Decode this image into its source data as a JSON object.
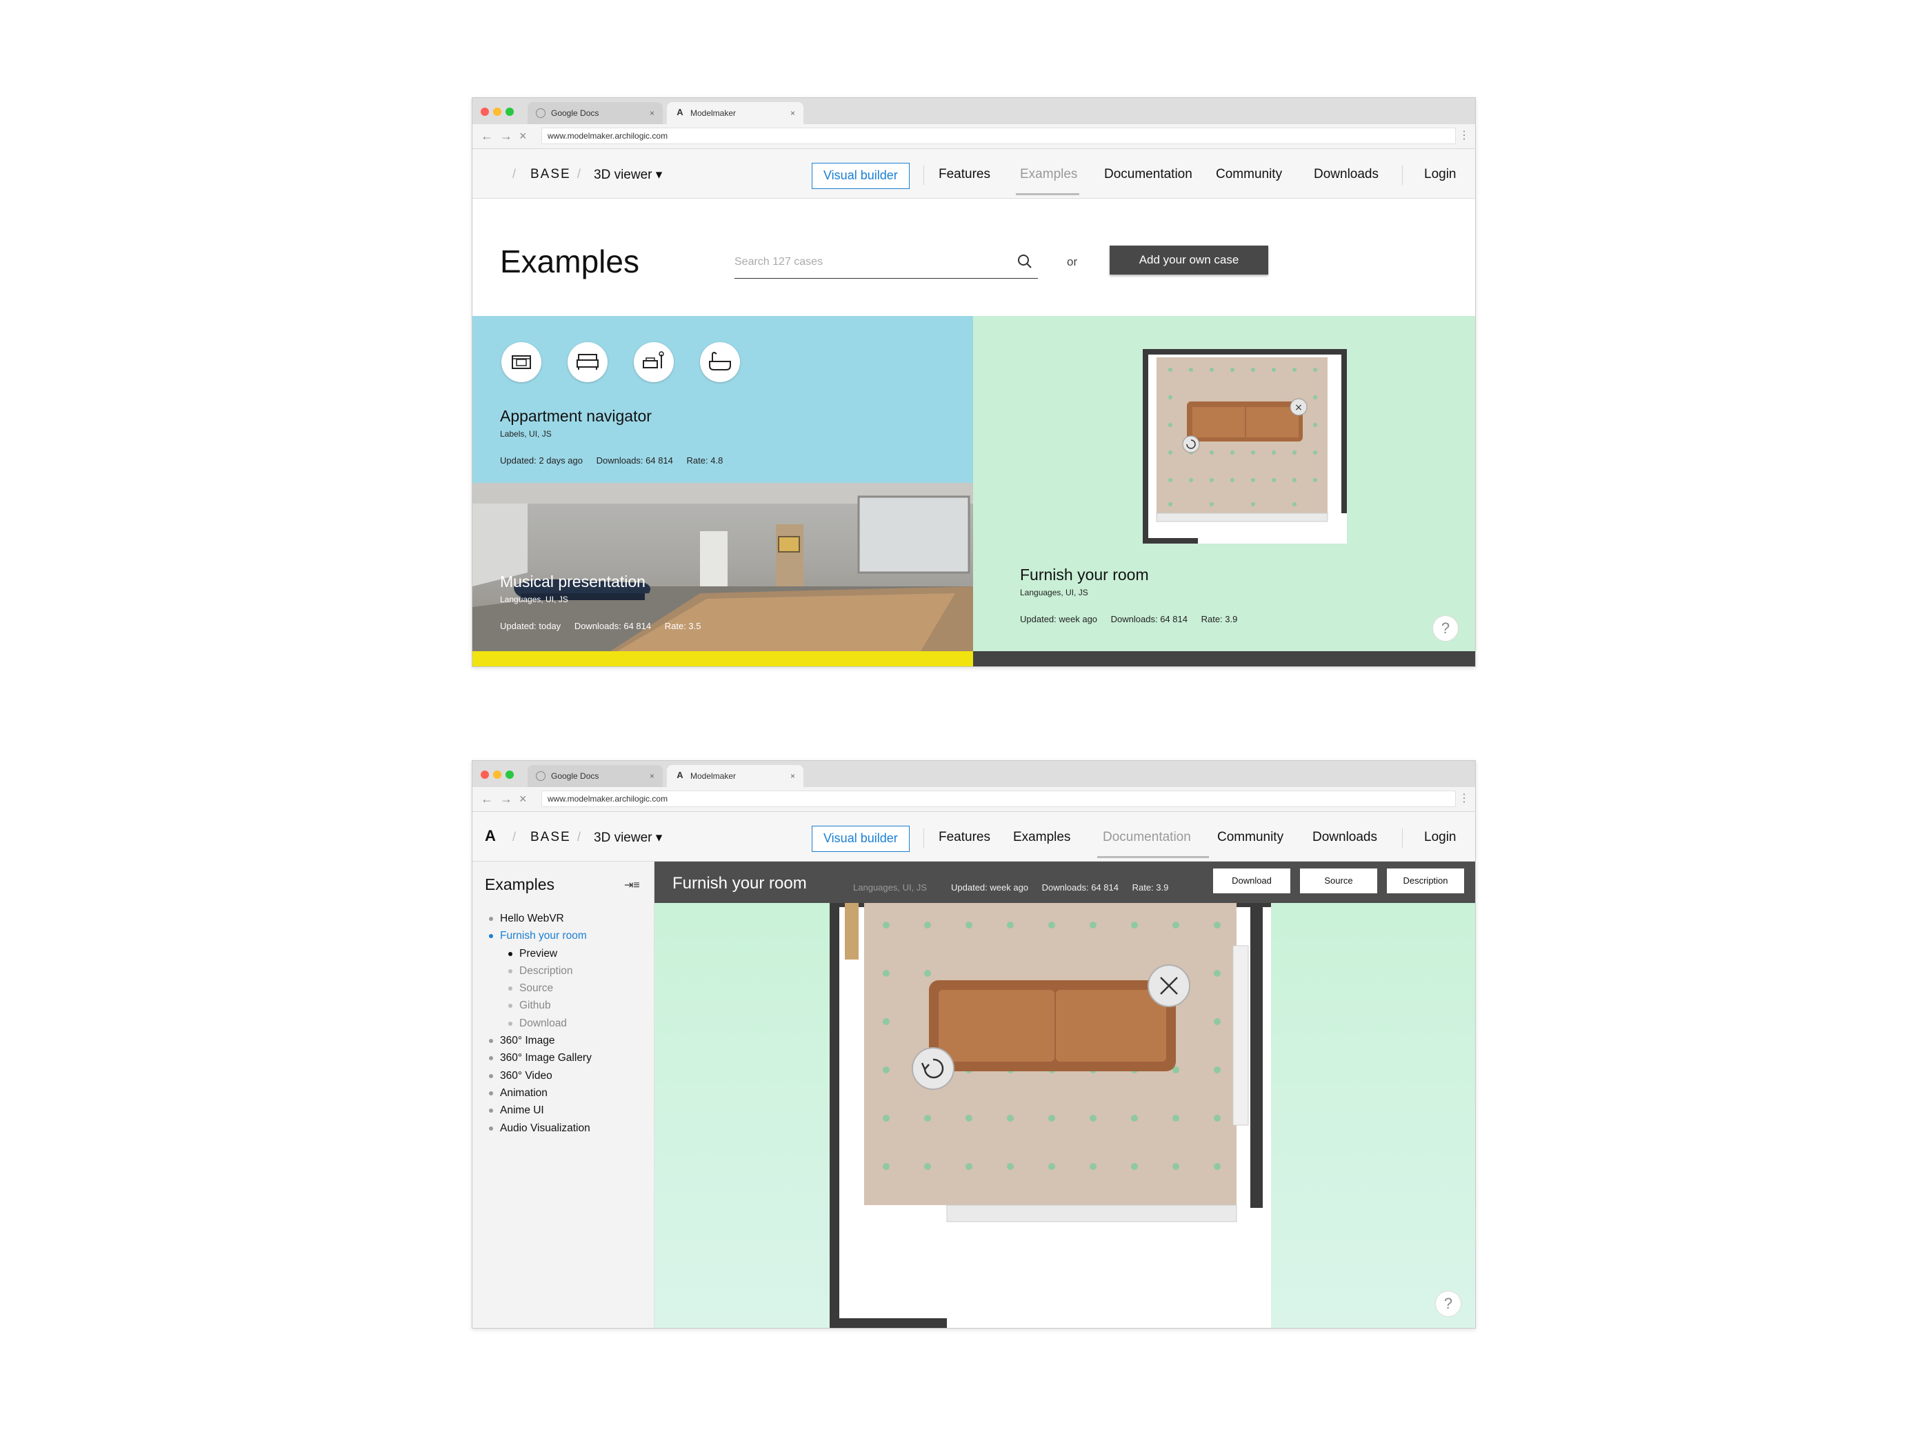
{
  "browser": {
    "tabs": [
      {
        "label": "Google Docs"
      },
      {
        "label": "Modelmaker"
      }
    ],
    "url": "www.modelmaker.archilogic.com"
  },
  "nav": {
    "base": "BASE",
    "viewer": "3D viewer ▾",
    "visual_builder": "Visual builder",
    "features": "Features",
    "examples": "Examples",
    "documentation": "Documentation",
    "community": "Community",
    "downloads": "Downloads",
    "login": "Login"
  },
  "examples_page": {
    "title": "Examples",
    "search_placeholder": "Search 127 cases",
    "or": "or",
    "add_case": "Add your own case",
    "cards": [
      {
        "title": "Appartment navigator",
        "tags": "Labels, UI, JS",
        "updated": "Updated: 2 days ago",
        "downloads": "Downloads: 64 814",
        "rate": "Rate: 4.8"
      },
      {
        "title": "Musical presentation",
        "tags": "Languages, UI, JS",
        "updated": "Updated: today",
        "downloads": "Downloads: 64 814",
        "rate": "Rate: 3.5"
      },
      {
        "title": "Furnish your room",
        "tags": "Languages, UI, JS",
        "updated": "Updated: week ago",
        "downloads": "Downloads: 64 814",
        "rate": "Rate: 3.9"
      }
    ],
    "help": "?"
  },
  "detail_page": {
    "sidebar_title": "Examples",
    "sidebar_items": [
      {
        "label": "Hello WebVR"
      },
      {
        "label": "Furnish your room"
      },
      {
        "label": "Preview"
      },
      {
        "label": "Description"
      },
      {
        "label": "Source"
      },
      {
        "label": "Github"
      },
      {
        "label": "Download"
      },
      {
        "label": "360° Image"
      },
      {
        "label": "360° Image Gallery"
      },
      {
        "label": "360° Video"
      },
      {
        "label": "Animation"
      },
      {
        "label": "Anime UI"
      },
      {
        "label": "Audio Visualization"
      }
    ],
    "view_title": "Furnish your room",
    "tags": "Languages, UI, JS",
    "updated": "Updated: week ago",
    "downloads": "Downloads: 64 814",
    "rate": "Rate: 3.9",
    "buttons": {
      "download": "Download",
      "source": "Source",
      "description": "Description"
    },
    "help": "?"
  },
  "colors": {
    "accent": "#1a7fd4",
    "blue_card": "#9bd8e7",
    "green_card": "#c9efd6",
    "yellow_bar": "#f0e30f",
    "dark": "#484848"
  }
}
